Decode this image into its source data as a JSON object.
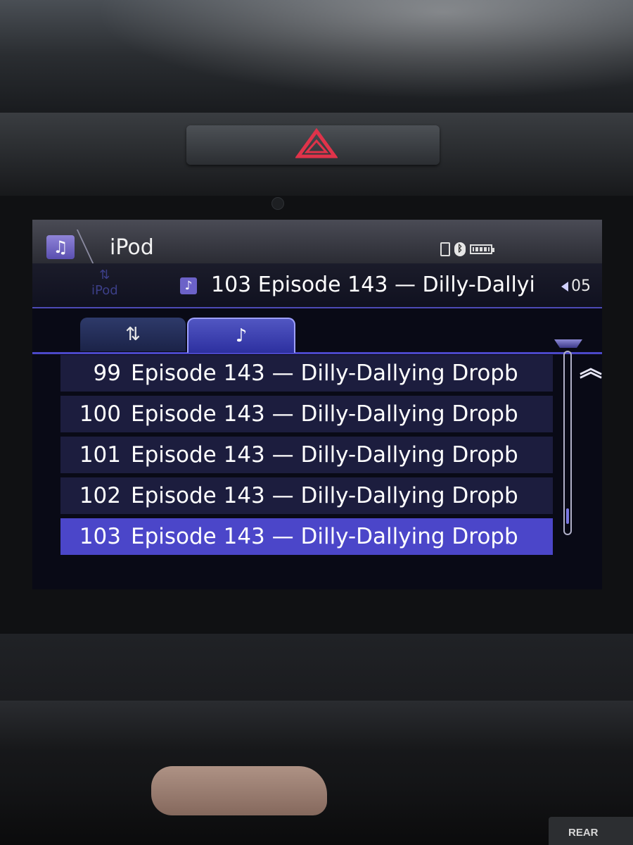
{
  "header": {
    "source": "iPod",
    "app_icon": "music-note-icon",
    "status_icons": [
      "phone-icon",
      "bluetooth-icon",
      "battery-icon"
    ]
  },
  "now_playing": {
    "track": "103 Episode 143 — Dilly-Dallyi",
    "volume": "05",
    "ghost_source": "iPod"
  },
  "tabs": [
    {
      "icon": "usb-icon",
      "glyph": "⇅",
      "selected": false
    },
    {
      "icon": "music-note-icon",
      "glyph": "♪",
      "selected": true
    }
  ],
  "tracks": [
    {
      "num": "99",
      "title": "Episode 143 — Dilly-Dallying Dropb",
      "selected": false
    },
    {
      "num": "100",
      "title": "Episode 143 — Dilly-Dallying Dropb",
      "selected": false
    },
    {
      "num": "101",
      "title": "Episode 143 — Dilly-Dallying Dropb",
      "selected": false
    },
    {
      "num": "102",
      "title": "Episode 143 — Dilly-Dallying Dropb",
      "selected": false
    },
    {
      "num": "103",
      "title": "Episode 143 — Dilly-Dallying Dropb",
      "selected": true
    }
  ],
  "scroll": {
    "position": 0.95
  },
  "console": {
    "rear_label": "REAR"
  },
  "colors": {
    "accent": "#4b46c9",
    "row": "#1c1d3e",
    "hazard": "#e0334a"
  }
}
